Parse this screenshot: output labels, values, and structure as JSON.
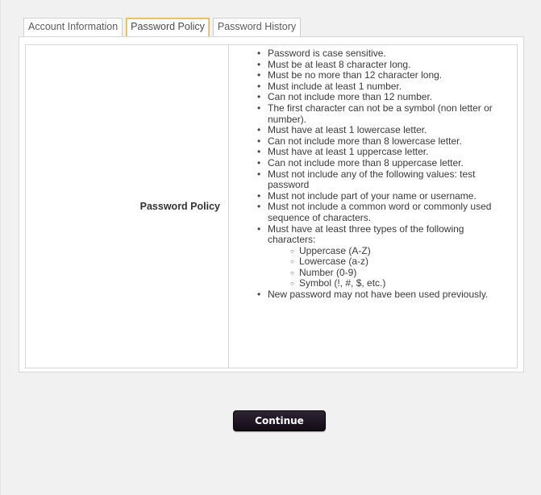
{
  "tabs": [
    {
      "label": "Account Information",
      "active": false
    },
    {
      "label": "Password Policy",
      "active": true
    },
    {
      "label": "Password History",
      "active": false
    }
  ],
  "policy": {
    "label": "Password Policy",
    "rules": [
      "Password is case sensitive.",
      "Must be at least 8 character long.",
      "Must be no more than 12 character long.",
      "Must include at least 1 number.",
      "Can not include more than 12 number.",
      "The first character can not be a symbol (non letter or number).",
      "Must have at least 1 lowercase letter.",
      "Can not include more than 8 lowercase letter.",
      "Must have at least 1 uppercase letter.",
      "Can not include more than 8 uppercase letter.",
      "Must not include any of the following values: test password",
      "Must not include part of your name or username.",
      "Must not include a common word or commonly used sequence of characters.",
      "Must have at least three types of the following characters:"
    ],
    "char_types": [
      "Uppercase (A-Z)",
      "Lowercase (a-z)",
      "Number (0-9)",
      "Symbol (!, #, $, etc.)"
    ],
    "final_rule": "New password may not have been used previously."
  },
  "continue_label": "Continue",
  "colors": {
    "active_tab_border": "#e2b24a",
    "button_bg": "#1e1622"
  }
}
